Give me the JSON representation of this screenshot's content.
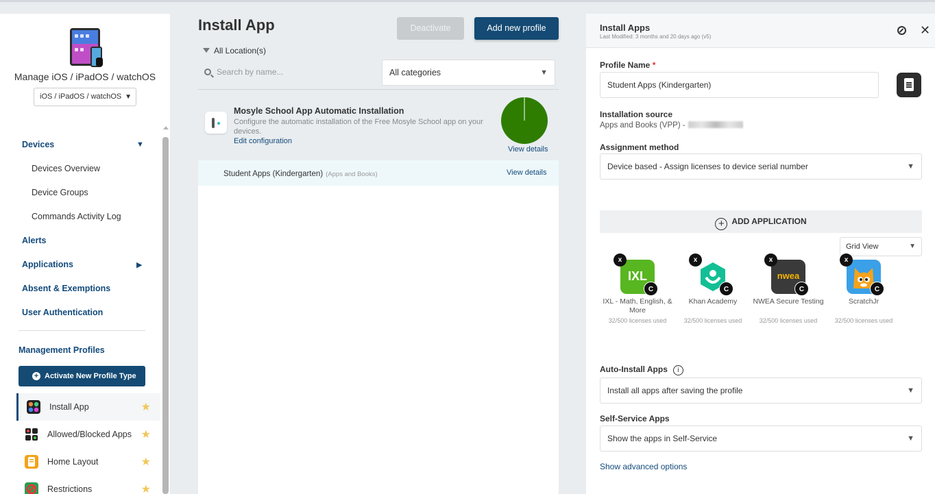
{
  "sidebar": {
    "title": "Manage iOS / iPadOS / watchOS",
    "os_select": "iOS / iPadOS / watchOS",
    "nav": {
      "devices": "Devices",
      "devices_overview": "Devices Overview",
      "device_groups": "Device Groups",
      "commands_log": "Commands Activity Log",
      "alerts": "Alerts",
      "applications": "Applications",
      "absent": "Absent & Exemptions",
      "user_auth": "User Authentication"
    },
    "management_profiles": "Management Profiles",
    "activate_btn": "Activate New Profile Type",
    "profiles": [
      {
        "label": "Install App",
        "icon": "install-app-icon"
      },
      {
        "label": "Allowed/Blocked Apps",
        "icon": "allowed-blocked-apps-icon"
      },
      {
        "label": "Home Layout",
        "icon": "home-layout-icon"
      },
      {
        "label": "Restrictions",
        "icon": "restrictions-icon"
      }
    ]
  },
  "main": {
    "title": "Install App",
    "deactivate": "Deactivate",
    "add_profile": "Add new profile",
    "location": "All Location(s)",
    "search_placeholder": "Search by name...",
    "category": "All categories",
    "mosyle": {
      "title": "Mosyle School App Automatic Installation",
      "desc": "Configure the automatic installation of the Free Mosyle School app on your devices.",
      "edit": "Edit configuration",
      "view": "View details",
      "install_progress_fraction": 0.99,
      "color": "#2e7d00"
    },
    "rows": [
      {
        "name": "Student Apps (Kindergarten)",
        "source": "(Apps and Books)",
        "view": "View details"
      }
    ]
  },
  "panel": {
    "title": "Install Apps",
    "last_modified": "Last Modified: 3 months and 20 days ago (v5)",
    "profile_name_label": "Profile Name",
    "required_mark": "*",
    "profile_name": "Student Apps (Kindergarten)",
    "install_source_label": "Installation source",
    "install_source": "Apps and Books (VPP) -",
    "assignment_label": "Assignment method",
    "assignment": "Device based - Assign licenses to device serial number",
    "add_application": "ADD APPLICATION",
    "view_mode": "Grid View",
    "apps": [
      {
        "name": "IXL - Math, English, & More",
        "licenses": "32/500 licenses used",
        "icon": "ixl-icon",
        "icon_text": "IXL",
        "badge_x": "x",
        "badge_c": "C"
      },
      {
        "name": "Khan Academy",
        "licenses": "32/500 licenses used",
        "icon": "khan-academy-icon",
        "icon_text": "",
        "badge_x": "x",
        "badge_c": "C"
      },
      {
        "name": "NWEA Secure Testing",
        "licenses": "32/500 licenses used",
        "icon": "nwea-icon",
        "icon_text": "nwea",
        "badge_x": "x",
        "badge_c": "C"
      },
      {
        "name": "ScratchJr",
        "licenses": "32/500 licenses used",
        "icon": "scratchjr-icon",
        "icon_text": "",
        "badge_x": "x",
        "badge_c": "C"
      }
    ],
    "auto_install_label": "Auto-Install Apps",
    "auto_install": "Install all apps after saving the profile",
    "self_service_label": "Self-Service Apps",
    "self_service": "Show the apps in Self-Service",
    "advanced": "Show advanced options"
  },
  "colors": {
    "primary": "#144a73",
    "link": "#134a7b",
    "star": "#f0c85a"
  }
}
